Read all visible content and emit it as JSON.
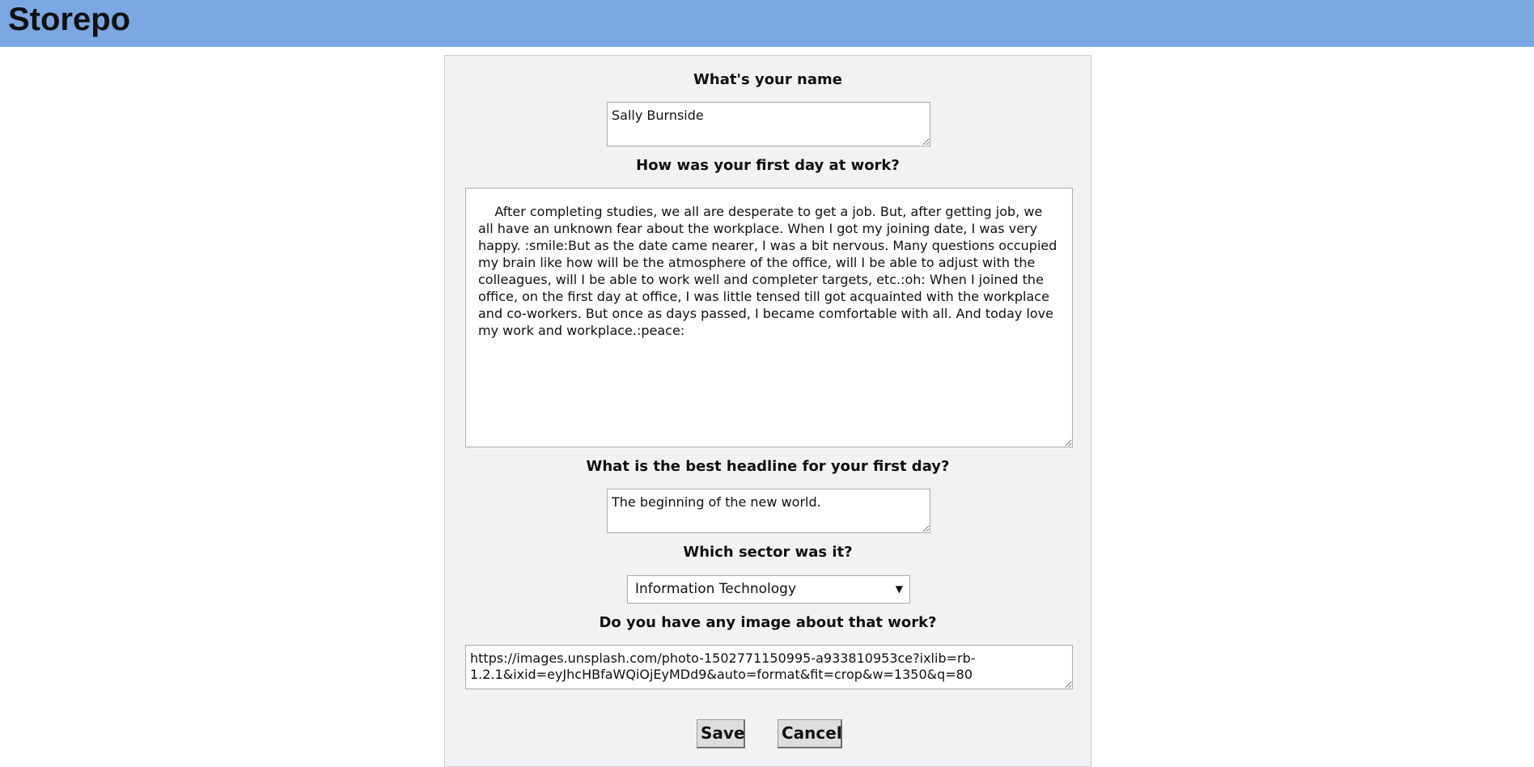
{
  "app": {
    "title": "Storepo"
  },
  "form": {
    "name_label": "What's your name",
    "name_value": "Sally Burnside",
    "story_label": "How was your first day at work?",
    "story_value": "    After completing studies, we all are desperate to get a job. But, after getting job, we all have an unknown fear about the workplace. When I got my joining date, I was very happy. :smile:But as the date came nearer, I was a bit nervous. Many questions occupied my brain like how will be the atmosphere of the office, will I be able to adjust with the colleagues, will I be able to work well and completer targets, etc.:oh: When I joined the office, on the first day at office, I was little tensed till got acquainted with the workplace and co-workers. But once as days passed, I became comfortable with all. And today love my work and workplace.:peace:",
    "headline_label": "What is the best headline for your first day?",
    "headline_value": "The beginning of the new world.",
    "sector_label": "Which sector was it?",
    "sector_selected": "Information Technology",
    "image_label": "Do you have any image about that work?",
    "image_value": "https://images.unsplash.com/photo-1502771150995-a933810953ce?ixlib=rb-1.2.1&ixid=eyJhcHBfaWQiOjEyMDd9&auto=format&fit=crop&w=1350&q=80",
    "save_label": "Save",
    "cancel_label": "Cancel"
  },
  "icons": {
    "select_arrow": "triangle-down-icon",
    "resize_grip": "resize-grip-icon"
  },
  "colors": {
    "topbar": "#7ba7e3",
    "panel": "#f2f2f4",
    "button": "#dedede"
  }
}
